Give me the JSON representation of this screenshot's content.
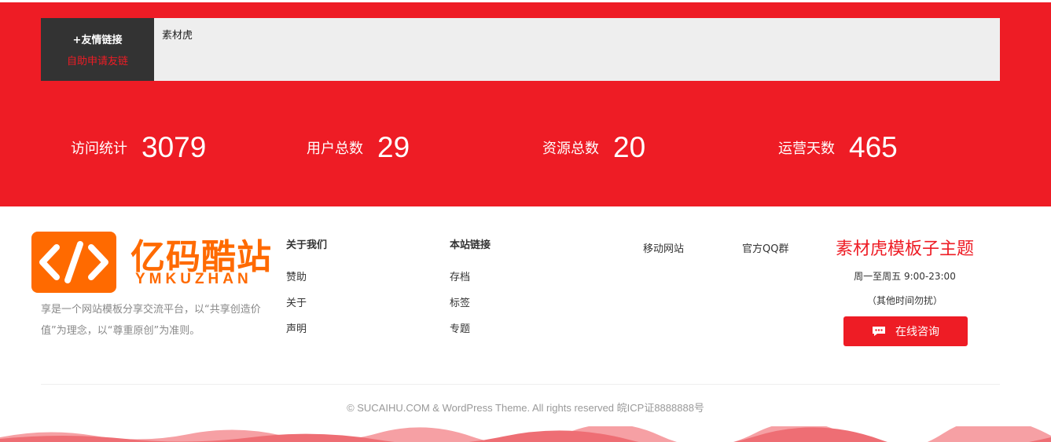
{
  "friends": {
    "title": "+友情链接",
    "apply_label": "自助申请友链",
    "links": [
      "素材虎"
    ]
  },
  "stats": [
    {
      "label": "访问统计",
      "value": "3079"
    },
    {
      "label": "用户总数",
      "value": "29"
    },
    {
      "label": "资源总数",
      "value": "20"
    },
    {
      "label": "运营天数",
      "value": "465"
    }
  ],
  "footer": {
    "logo": {
      "text": "亿码酷站",
      "sub": "YMKUZHAN"
    },
    "about": "享是一个网站模板分享交流平台，以“共享创造价值”为理念，以“尊重原创”为准则。",
    "columns": [
      {
        "title": "关于我们",
        "links": [
          "赞助",
          "关于",
          "声明"
        ]
      },
      {
        "title": "本站链接",
        "links": [
          "存档",
          "标签",
          "专题"
        ]
      }
    ],
    "qr_labels": [
      "移动网站",
      "官方QQ群"
    ],
    "contact": {
      "title": "素材虎模板子主题",
      "hours": "周一至周五 9:00-23:00",
      "note": "（其他时间勿扰）",
      "button": "在线咨询"
    },
    "copyright": "© SUCAIHU.COM & WordPress Theme. All rights reserved  皖ICP证8888888号"
  },
  "colors": {
    "brand_red": "#ee1c25",
    "logo_orange": "#ff6a00",
    "dark": "#333333"
  },
  "icons": {
    "consult": "chat-bubble-icon",
    "logo": "code-brackets-icon"
  }
}
